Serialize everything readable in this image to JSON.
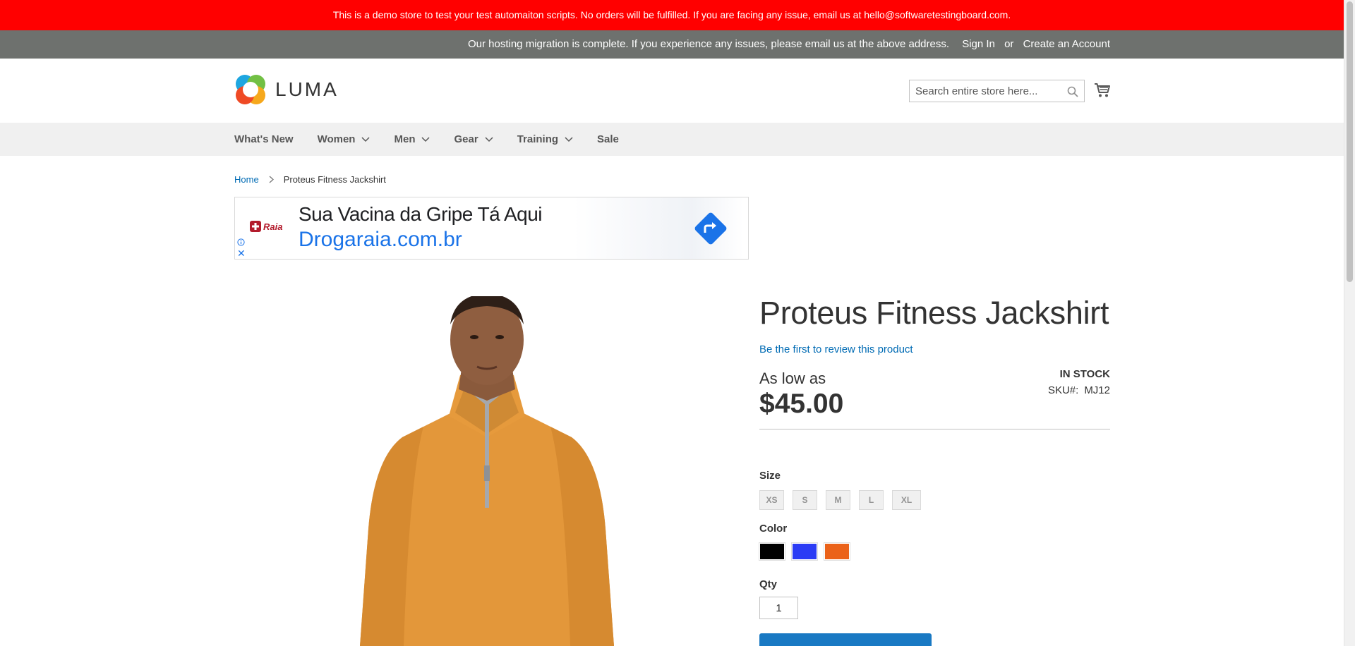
{
  "demo_notice": "This is a demo store to test your test automaiton scripts. No orders will be fulfilled. If you are facing any issue, email us at hello@softwaretestingboard.com.",
  "panel_header": {
    "notice": "Our hosting migration is complete. If you experience any issues, please email us at the above address.",
    "sign_in": "Sign In",
    "or": "or",
    "create_account": "Create an Account"
  },
  "logo": {
    "text": "LUMA"
  },
  "search": {
    "placeholder": "Search entire store here...",
    "icon": "search-icon"
  },
  "cart": {
    "icon": "cart-icon"
  },
  "nav": {
    "items": [
      {
        "label": "What's New",
        "has_dropdown": false
      },
      {
        "label": "Women",
        "has_dropdown": true
      },
      {
        "label": "Men",
        "has_dropdown": true
      },
      {
        "label": "Gear",
        "has_dropdown": true
      },
      {
        "label": "Training",
        "has_dropdown": true
      },
      {
        "label": "Sale",
        "has_dropdown": false
      }
    ]
  },
  "breadcrumb": {
    "home": "Home",
    "current": "Proteus Fitness Jackshirt"
  },
  "ad": {
    "brand": "Raia",
    "headline": "Sua Vacina da Gripe Tá Aqui",
    "url": "Drogaraia.com.br",
    "close": "✕"
  },
  "product": {
    "title": "Proteus Fitness Jackshirt",
    "review_link": "Be the first to review this product",
    "as_low_as": "As low as",
    "price": "$45.00",
    "stock": "IN STOCK",
    "sku_label": "SKU#:",
    "sku": "MJ12",
    "size_label": "Size",
    "sizes": [
      "XS",
      "S",
      "M",
      "L",
      "XL"
    ],
    "color_label": "Color",
    "colors": [
      "#000000",
      "#2b3cf5",
      "#eb6219"
    ],
    "qty_label": "Qty",
    "qty": "1"
  },
  "colors": {
    "demo_bar": "#ff0000",
    "panel_header": "#6e716e",
    "link": "#006bb4",
    "add_to_cart": "#1979c3"
  }
}
